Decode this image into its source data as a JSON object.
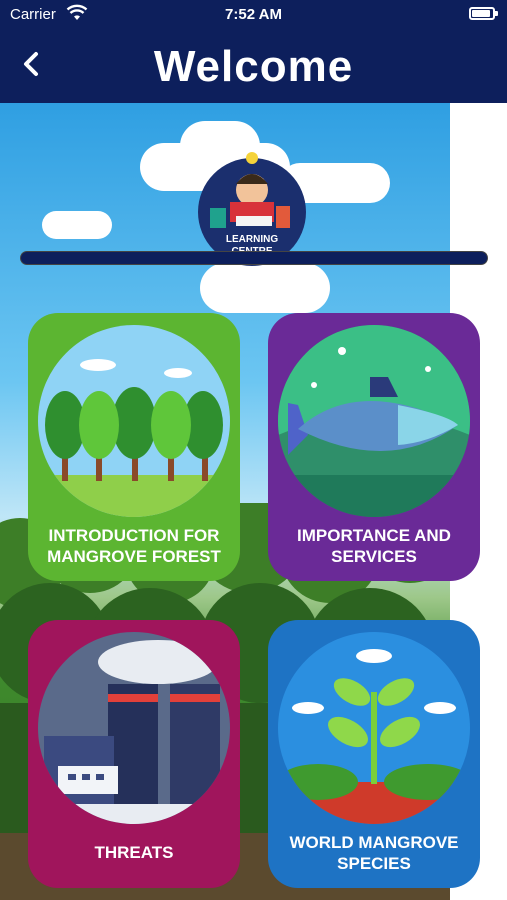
{
  "status_bar": {
    "carrier": "Carrier",
    "time": "7:52 AM"
  },
  "nav": {
    "title": "Welcome",
    "back_icon": "chevron-left-icon"
  },
  "logo": {
    "line1": "LEARNING",
    "line2": "CENTRE",
    "progress": 1.0
  },
  "tiles": [
    {
      "label": "INTRODUCTION FOR MANGROVE FOREST",
      "color": "#5cb531",
      "icon": "forest-trees-icon"
    },
    {
      "label": "IMPORTANCE AND SERVICES",
      "color": "#6a2a97",
      "icon": "fish-icon"
    },
    {
      "label": "THREATS",
      "color": "#a0155c",
      "icon": "factory-icon"
    },
    {
      "label": "WORLD MANGROVE SPECIES",
      "color": "#1e73c4",
      "icon": "seedling-icon"
    }
  ],
  "colors": {
    "nav_bg": "#0d1f5c"
  }
}
